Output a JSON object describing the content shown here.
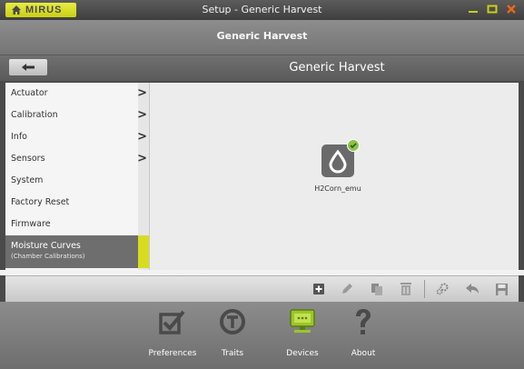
{
  "window": {
    "brand": "MIRUS",
    "title": "Setup - Generic Harvest",
    "controls": [
      "minimize",
      "maximize",
      "close"
    ],
    "accent_color": "#c9cf16",
    "close_color": "#e86a16"
  },
  "subheader": {
    "title": "Generic Harvest"
  },
  "header": {
    "title": "Generic Harvest",
    "back_icon": "back-arrow-icon"
  },
  "sidebar": {
    "items": [
      {
        "label": "Actuator",
        "has_children": true
      },
      {
        "label": "Calibration",
        "has_children": true
      },
      {
        "label": "Info",
        "has_children": true
      },
      {
        "label": "Sensors",
        "has_children": true
      },
      {
        "label": "System",
        "has_children": false
      },
      {
        "label": "Factory Reset",
        "has_children": false
      },
      {
        "label": "Firmware",
        "has_children": false
      }
    ],
    "active_item": {
      "label": "Moisture Curves",
      "sublabel": "(Chamber Calibrations)"
    }
  },
  "main": {
    "device": {
      "label": "H2Corn_emu",
      "icon": "water-drop-icon",
      "status": "ok"
    }
  },
  "toolbar": {
    "buttons": [
      "add-icon",
      "edit-icon",
      "copy-icon",
      "delete-icon",
      "settings-icon",
      "undo-icon",
      "save-icon"
    ]
  },
  "bottom_nav": {
    "items": [
      {
        "label": "Preferences",
        "icon": "checklist-icon"
      },
      {
        "label": "Traits",
        "icon": "traits-icon"
      },
      {
        "label": "Devices",
        "icon": "devices-icon"
      },
      {
        "label": "About",
        "icon": "help-icon"
      }
    ],
    "active": "Devices"
  }
}
